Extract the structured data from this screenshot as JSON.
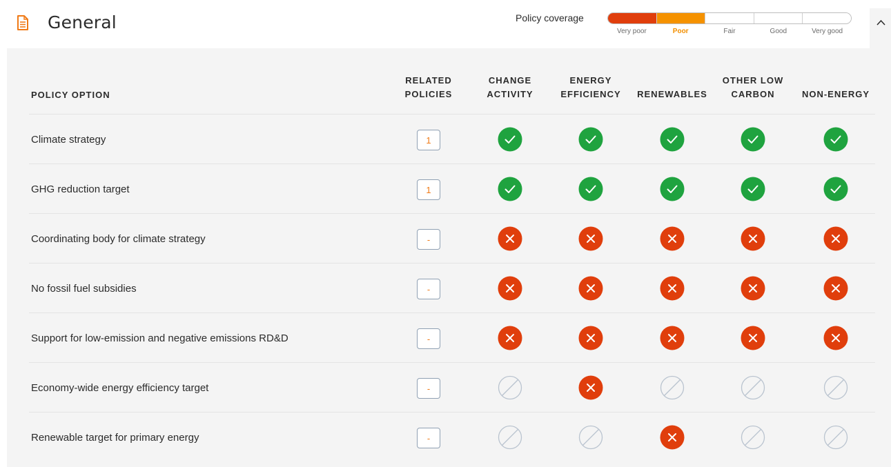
{
  "header": {
    "title": "General",
    "icon": "document-icon",
    "coverage_label": "Policy coverage",
    "coverage_levels": [
      "Very poor",
      "Poor",
      "Fair",
      "Good",
      "Very good"
    ],
    "coverage_selected": "Poor",
    "coverage_colors": [
      "#e03e0c",
      "#f59200",
      "#ffffff",
      "#ffffff",
      "#ffffff"
    ],
    "collapse_icon": "chevron-up-icon"
  },
  "table": {
    "headers": {
      "policy_option": "POLICY OPTION",
      "related": "RELATED\nPOLICIES",
      "change": "CHANGE\nACTIVITY",
      "efficiency": "ENERGY\nEFFICIENCY",
      "renewables": "RENEWABLES",
      "other": "OTHER LOW\nCARBON",
      "nonenergy": "NON-ENERGY"
    },
    "rows": [
      {
        "label": "Climate strategy",
        "related": "1",
        "status": [
          "yes",
          "yes",
          "yes",
          "yes",
          "yes"
        ]
      },
      {
        "label": "GHG reduction target",
        "related": "1",
        "status": [
          "yes",
          "yes",
          "yes",
          "yes",
          "yes"
        ]
      },
      {
        "label": "Coordinating body for climate strategy",
        "related": "-",
        "status": [
          "no",
          "no",
          "no",
          "no",
          "no"
        ]
      },
      {
        "label": "No fossil fuel subsidies",
        "related": "-",
        "status": [
          "no",
          "no",
          "no",
          "no",
          "no"
        ]
      },
      {
        "label": "Support for low-emission and negative emissions RD&D",
        "related": "-",
        "status": [
          "no",
          "no",
          "no",
          "no",
          "no"
        ]
      },
      {
        "label": "Economy-wide energy efficiency target",
        "related": "-",
        "status": [
          "na",
          "no",
          "na",
          "na",
          "na"
        ]
      },
      {
        "label": "Renewable target for primary energy",
        "related": "-",
        "status": [
          "na",
          "na",
          "no",
          "na",
          "na"
        ]
      }
    ]
  },
  "colors": {
    "yes": "#1fa33f",
    "no": "#e03e0c",
    "na_stroke": "#b9c3cf",
    "related_text": "#f07a16",
    "accent_poor": "#f28f00"
  }
}
